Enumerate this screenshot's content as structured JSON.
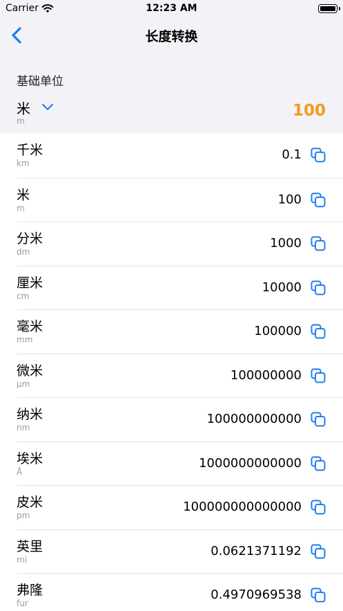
{
  "status_bar": {
    "carrier": "Carrier",
    "time": "12:23 AM"
  },
  "nav": {
    "title": "长度转换",
    "back_icon": "chevron-left-icon"
  },
  "base": {
    "label": "基础单位",
    "unit_name": "米",
    "unit_symbol": "m",
    "value": "100",
    "value_color": "#f39a1e"
  },
  "accent_color": "#1a7cf5",
  "units": [
    {
      "name": "千米",
      "symbol": "km",
      "value": "0.1"
    },
    {
      "name": "米",
      "symbol": "m",
      "value": "100"
    },
    {
      "name": "分米",
      "symbol": "dm",
      "value": "1000"
    },
    {
      "name": "厘米",
      "symbol": "cm",
      "value": "10000"
    },
    {
      "name": "毫米",
      "symbol": "mm",
      "value": "100000"
    },
    {
      "name": "微米",
      "symbol": "μm",
      "value": "100000000"
    },
    {
      "name": "纳米",
      "symbol": "nm",
      "value": "100000000000"
    },
    {
      "name": "埃米",
      "symbol": "Å",
      "value": "1000000000000"
    },
    {
      "name": "皮米",
      "symbol": "pm",
      "value": "100000000000000"
    },
    {
      "name": "英里",
      "symbol": "mi",
      "value": "0.0621371192"
    },
    {
      "name": "弗隆",
      "symbol": "fur",
      "value": "0.4970969538"
    }
  ]
}
